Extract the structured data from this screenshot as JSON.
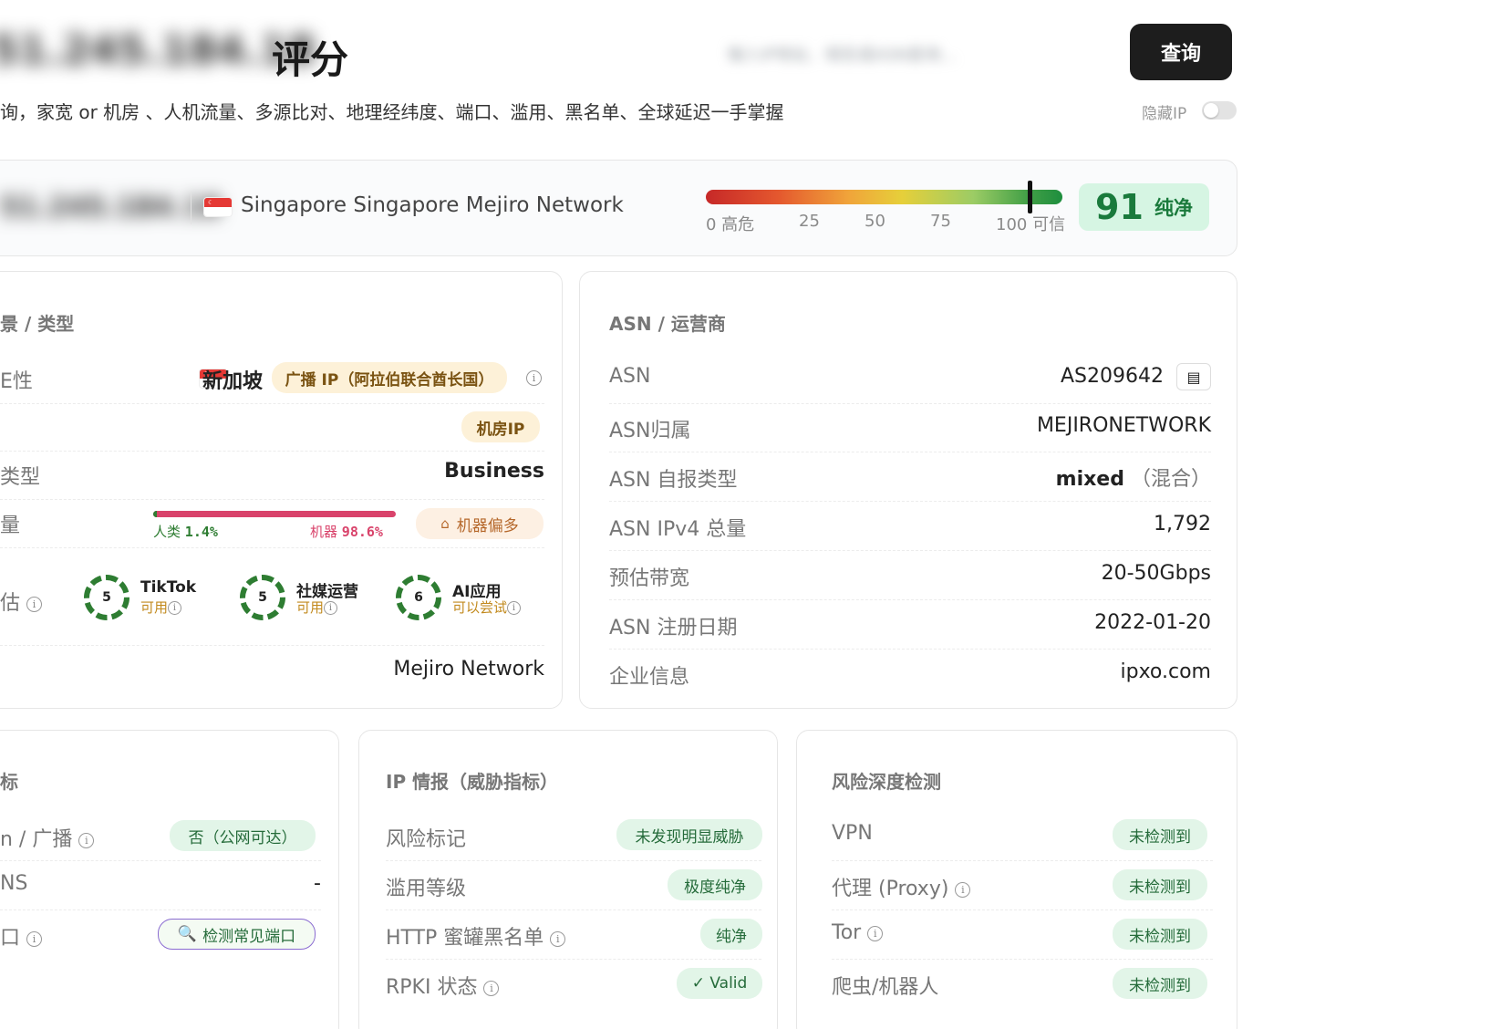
{
  "header": {
    "title_ip": "51.245.184.18",
    "title_suffix": "评分",
    "search_placeholder": "输入IP地址、域名或ASN查询...",
    "query_button": "查询",
    "subtitle": "询，家宽 or 机房 、人机流量、多源比对、地理经纬度、端口、滥用、黑名单、全球延迟一手掌握",
    "hide_ip_label": "隐藏IP",
    "hide_ip_enabled": false
  },
  "score_bar": {
    "ip": "51.245.184.18",
    "location": "Singapore Singapore Mejiro Network",
    "ticks": [
      "0 高危",
      "25",
      "50",
      "75",
      "100 可信"
    ],
    "score": 91,
    "status": "纯净",
    "marker_value": 91
  },
  "left_card": {
    "title": "景 / 类型",
    "rows": {
      "attr_label": "E性",
      "country": "新加坡",
      "broadcast_badge": "广播 IP（阿拉伯联合酋长国）",
      "datacenter_badge": "机房IP",
      "type_label": "类型",
      "type_value": "Business",
      "traffic_label": "量",
      "human_label": "人类",
      "human_pct": "1.4%",
      "bot_label": "机器",
      "bot_pct": "98.6%",
      "human_fraction": 0.014,
      "traffic_badge": "机器偏多",
      "estimate_label": "估",
      "org_label": "",
      "org_value": "Mejiro Network"
    },
    "services": [
      {
        "score": "5",
        "name": "TikTok",
        "status": "可用"
      },
      {
        "score": "5",
        "name": "社媒运营",
        "status": "可用"
      },
      {
        "score": "6",
        "name": "AI应用",
        "status": "可以尝试"
      }
    ]
  },
  "asn_card": {
    "title": "ASN / 运营商",
    "rows": [
      {
        "label": "ASN",
        "value": "AS209642"
      },
      {
        "label": "ASN归属",
        "value": "MEJIRONETWORK"
      },
      {
        "label": "ASN 自报类型",
        "value": "mixed",
        "extra": "（混合）"
      },
      {
        "label": "ASN IPv4 总量",
        "value": "1,792"
      },
      {
        "label": "预估带宽",
        "value": "20-50Gbps"
      },
      {
        "label": "ASN 注册日期",
        "value": "2022-01-20"
      },
      {
        "label": "企业信息",
        "value": "ipxo.com"
      }
    ]
  },
  "bottom_left_card": {
    "title": "标",
    "rows": [
      {
        "label": "n / 广播",
        "value": "否（公网可达）"
      },
      {
        "label": "NS",
        "value": "-"
      },
      {
        "label": "口",
        "value": "检测常见端口"
      }
    ]
  },
  "intel_card": {
    "title": "IP 情报（威胁指标）",
    "rows": [
      {
        "label": "风险标记",
        "value": "未发现明显威胁"
      },
      {
        "label": "滥用等级",
        "value": "极度纯净"
      },
      {
        "label": "HTTP 蜜罐黑名单",
        "value": "纯净"
      },
      {
        "label": "RPKI 状态",
        "value": "✓ Valid"
      }
    ]
  },
  "risk_card": {
    "title": "风险深度检测",
    "rows": [
      {
        "label": "VPN",
        "value": "未检测到"
      },
      {
        "label": "代理 (Proxy)",
        "value": "未检测到"
      },
      {
        "label": "Tor",
        "value": "未检测到"
      },
      {
        "label": "爬虫/机器人",
        "value": "未检测到"
      }
    ]
  },
  "colors": {
    "accent_green": "#1a7a3c",
    "bot_red": "#d9436b",
    "human_green": "#2e7d32"
  }
}
